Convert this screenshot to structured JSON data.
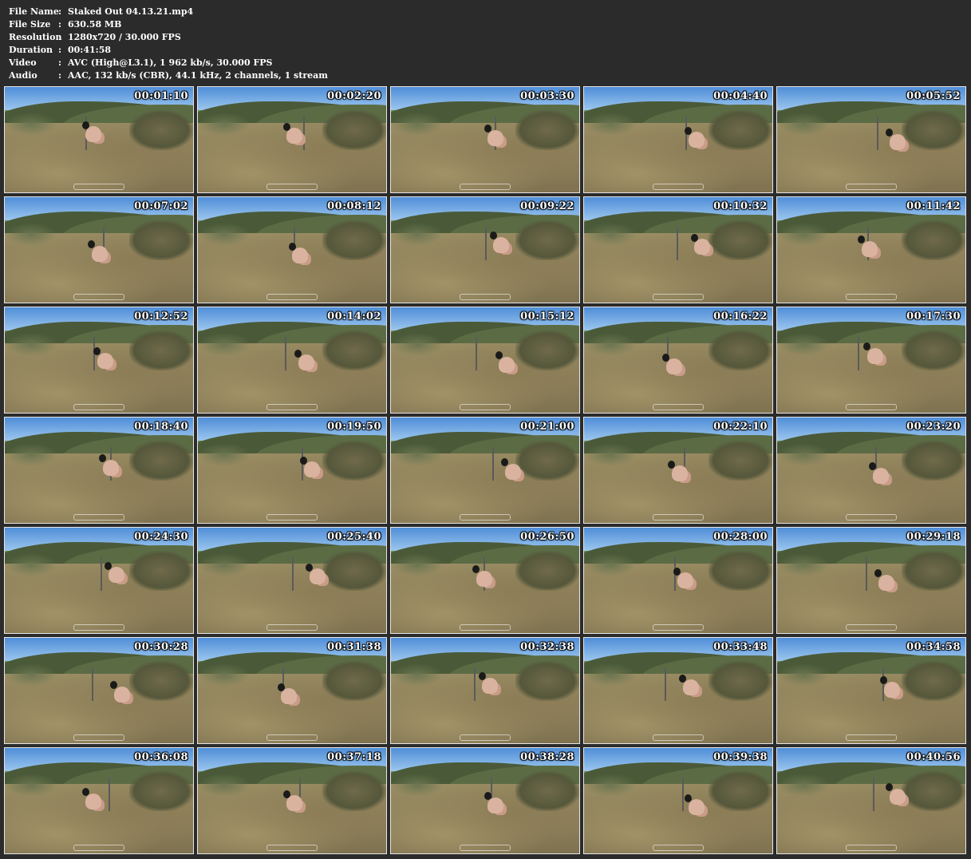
{
  "info": [
    {
      "label": "File Name",
      "sep": ":",
      "value": "Staked Out 04.13.21.mp4"
    },
    {
      "label": "File Size",
      "sep": ":",
      "value": "630.58 MB"
    },
    {
      "label": "Resolution",
      "sep": ":",
      "value": "1280x720 / 30.000 FPS"
    },
    {
      "label": "Duration",
      "sep": ":",
      "value": "00:41:58"
    },
    {
      "label": "Video",
      "sep": ":",
      "value": "AVC (High@L3.1), 1 962 kb/s, 30.000 FPS"
    },
    {
      "label": "Audio",
      "sep": ":",
      "value": "AAC, 132 kb/s (CBR), 44.1 kHz, 2 channels, 1 stream"
    }
  ],
  "thumbnails": [
    "00:01:10",
    "00:02:20",
    "00:03:30",
    "00:04:40",
    "00:05:52",
    "00:07:02",
    "00:08:12",
    "00:09:22",
    "00:10:32",
    "00:11:42",
    "00:12:52",
    "00:14:02",
    "00:15:12",
    "00:16:22",
    "00:17:30",
    "00:18:40",
    "00:19:50",
    "00:21:00",
    "00:22:10",
    "00:23:20",
    "00:24:30",
    "00:25:40",
    "00:26:50",
    "00:28:00",
    "00:29:18",
    "00:30:28",
    "00:31:38",
    "00:32:38",
    "00:33:48",
    "00:34:58",
    "00:36:08",
    "00:37:18",
    "00:38:28",
    "00:39:38",
    "00:40:56"
  ]
}
